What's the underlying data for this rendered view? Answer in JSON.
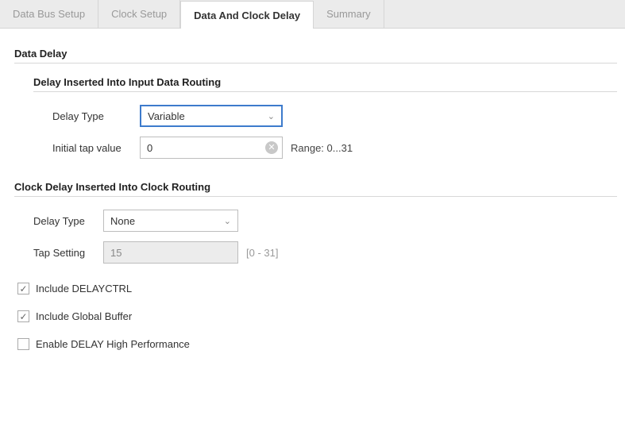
{
  "tabs": {
    "data_bus": "Data Bus Setup",
    "clock_setup": "Clock Setup",
    "delay": "Data And Clock Delay",
    "summary": "Summary"
  },
  "data_delay": {
    "header": "Data Delay",
    "input_routing_header": "Delay Inserted Into Input Data Routing",
    "delay_type_label": "Delay Type",
    "delay_type_value": "Variable",
    "initial_tap_label": "Initial tap value",
    "initial_tap_value": "0",
    "initial_tap_range": "Range: 0...31"
  },
  "clock_delay": {
    "header": "Clock Delay Inserted Into Clock Routing",
    "delay_type_label": "Delay Type",
    "delay_type_value": "None",
    "tap_label": "Tap Setting",
    "tap_value": "15",
    "tap_range": "[0 - 31]"
  },
  "options": {
    "delayctrl": "Include DELAYCTRL",
    "global_buffer": "Include Global Buffer",
    "high_perf": "Enable DELAY High Performance"
  },
  "glyphs": {
    "check": "✓",
    "chevron": "⌄",
    "clear": "✕"
  }
}
